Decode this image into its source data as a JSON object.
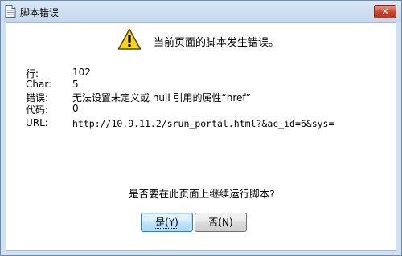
{
  "window": {
    "title": "脚本错误",
    "close_icon": "close-icon",
    "close_label": "✕"
  },
  "message": {
    "icon": "warning-icon",
    "headline": "当前页面的脚本发生错误。"
  },
  "details": {
    "line_label": "行:",
    "line_value": "102",
    "char_label": "Char:",
    "char_value": "5",
    "error_label": "错误:",
    "error_value": "无法设置未定义或 null 引用的属性“href”",
    "code_label": "代码:",
    "code_value": "0",
    "url_label": "URL:",
    "url_value": "http://10.9.11.2/srun_portal.html?&ac_id=6&sys="
  },
  "prompt": {
    "question": "是否要在此页面上继续运行脚本?"
  },
  "buttons": {
    "yes_label": "是(Y)",
    "no_label": "否(N)"
  },
  "colors": {
    "frame": "#cfe0f1",
    "close_button": "#c7452d",
    "warning_fill": "#f8d616",
    "default_button_border": "#3c7fb1"
  }
}
